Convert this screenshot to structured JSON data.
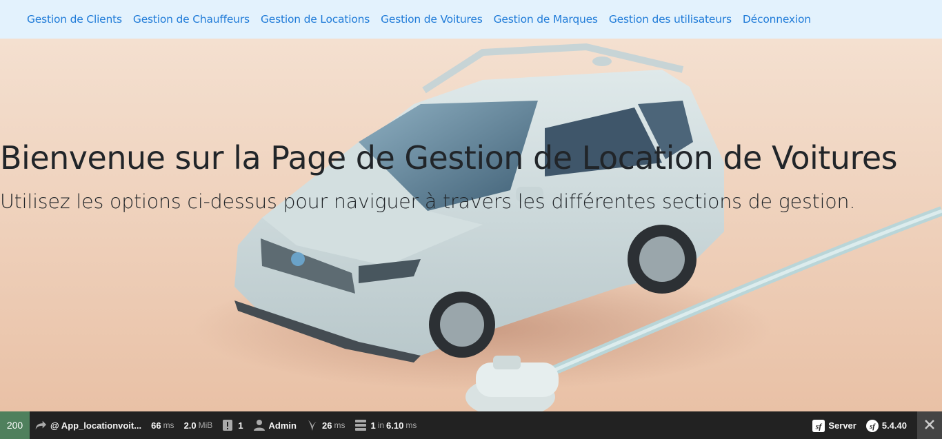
{
  "nav": {
    "items": [
      "Gestion de Clients",
      "Gestion de Chauffeurs",
      "Gestion de Locations",
      "Gestion de Voitures",
      "Gestion de Marques",
      "Gestion des utilisateurs",
      "Déconnexion"
    ],
    "link_color": "#1f7bd8",
    "background": "#e3f2fd"
  },
  "hero": {
    "title": "Bienvenue sur la Page de Gestion de Location de Voitures",
    "subtitle": "Utilisez les options ci-dessus pour naviguer à travers les différentes sections de gestion."
  },
  "toolbar": {
    "status_code": "200",
    "route": "@ App_locationvoit...",
    "time_value": "66",
    "time_unit": "ms",
    "memory_value": "2.0",
    "memory_unit": "MiB",
    "logs_count": "1",
    "user": "Admin",
    "twig_value": "26",
    "twig_unit": "ms",
    "db_queries": "1",
    "db_in": "in",
    "db_time": "6.10",
    "db_unit": "ms",
    "server_label": "Server",
    "sf_version": "5.4.40",
    "status_color": "#4f805d"
  }
}
